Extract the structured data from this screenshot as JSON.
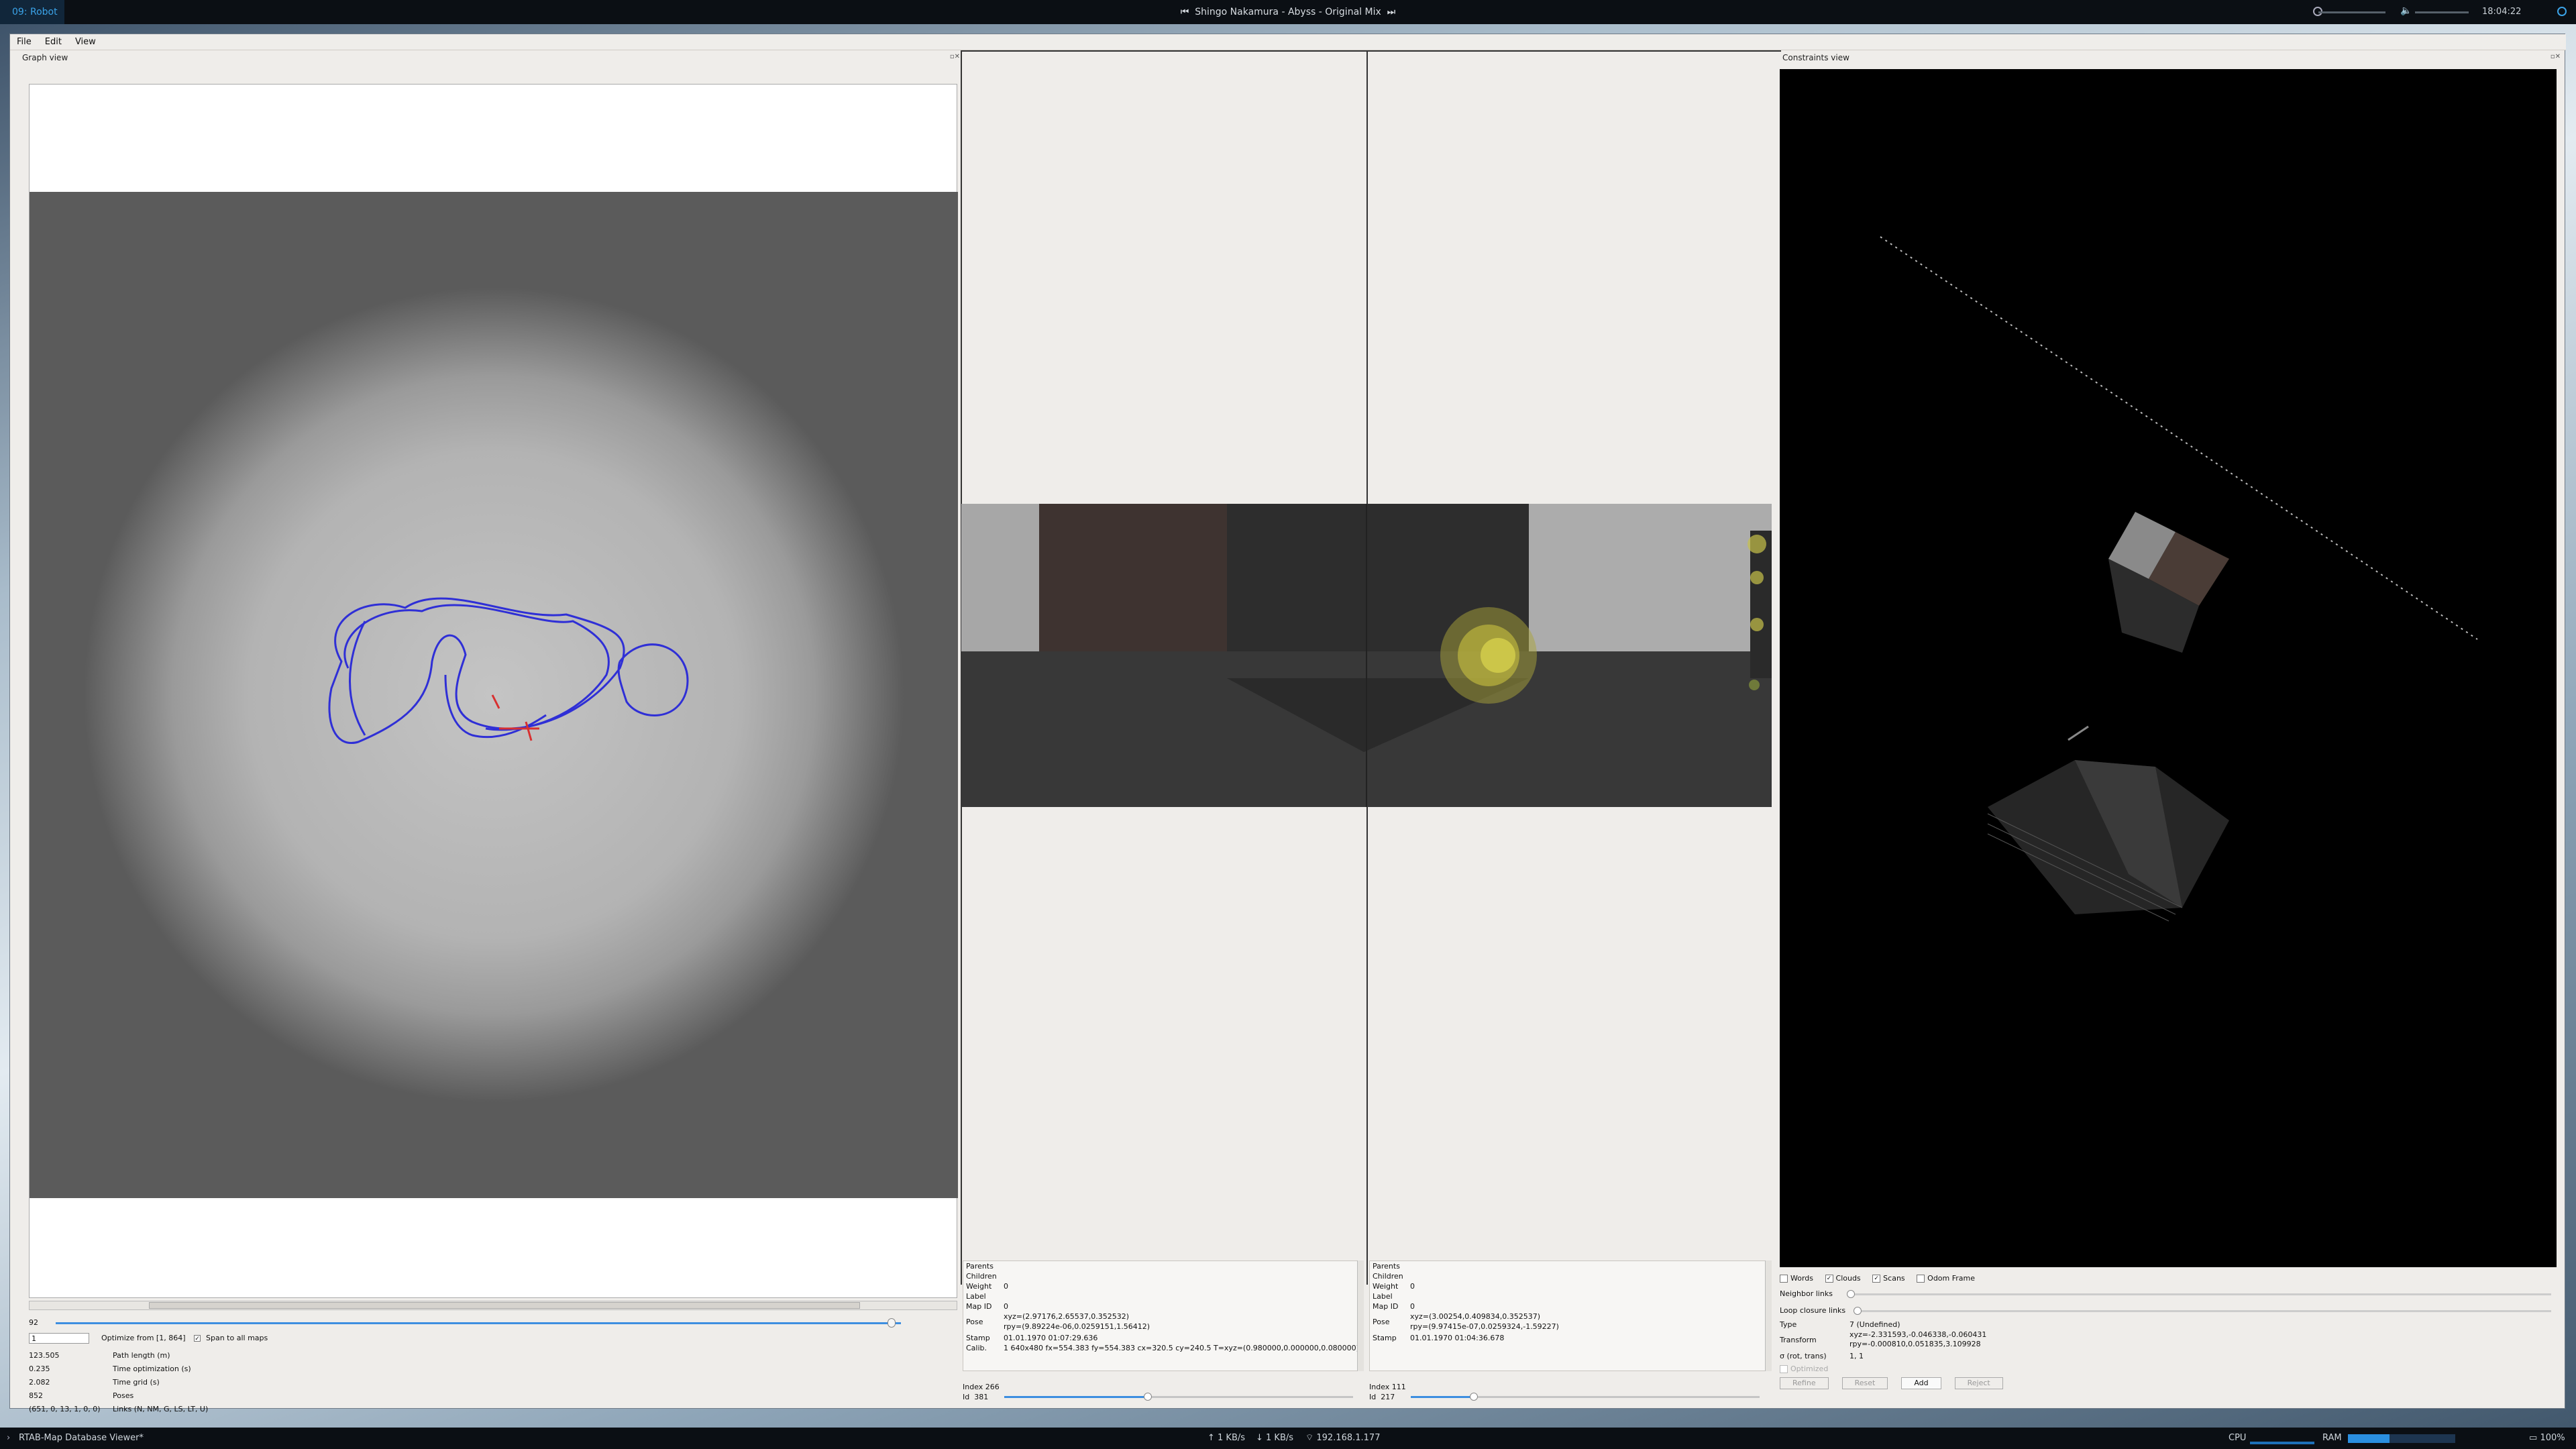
{
  "topbar": {
    "workspace": "09: Robot",
    "song": "Shingo Nakamura - Abyss - Original Mix",
    "clock": "18:04:22"
  },
  "window": {
    "menus": [
      "File",
      "Edit",
      "View"
    ]
  },
  "graph_view": {
    "title": "Graph view",
    "slider_label": "92",
    "optimize_value": "1",
    "optimize_label": "Optimize from [1, 864]",
    "span_label": "Span to all maps",
    "stats": [
      {
        "value": "123.505",
        "label": "Path length (m)"
      },
      {
        "value": "0.235",
        "label": "Time optimization (s)"
      },
      {
        "value": "2.082",
        "label": "Time grid (s)"
      },
      {
        "value": "852",
        "label": "Poses"
      },
      {
        "value": "(651, 0, 13, 1, 0, 0)",
        "label": "Links (N, NM, G, LS, LT, U)"
      }
    ]
  },
  "node_a": {
    "parents": "Parents",
    "children": "Children",
    "weight_label": "Weight",
    "weight": "0",
    "label_label": "Label",
    "label": "",
    "mapid_label": "Map ID",
    "mapid": "0",
    "pose_label": "Pose",
    "pose_xyz": "xyz=(2.97176,2.65537,0.352532)",
    "pose_rpy": "rpy=(9.89224e-06,0.0259151,1.56412)",
    "stamp_label": "Stamp",
    "stamp": "01.01.1970 01:07:29.636",
    "calib_label": "Calib.",
    "calib": "1 640x480 fx=554.383 fy=554.383 cx=320.5 cy=240.5 T=xyz=(0.980000,0.000000,0.080000) rpy=(...)",
    "index_label": "Index",
    "index": "266",
    "id_label": "Id",
    "id": "381"
  },
  "node_b": {
    "parents": "Parents",
    "children": "Children",
    "weight_label": "Weight",
    "weight": "0",
    "label_label": "Label",
    "label": "",
    "mapid_label": "Map ID",
    "mapid": "0",
    "pose_label": "Pose",
    "pose_xyz": "xyz=(3.00254,0.409834,0.352537)",
    "pose_rpy": "rpy=(9.97415e-07,0.0259324,-1.59227)",
    "stamp_label": "Stamp",
    "stamp": "01.01.1970 01:04:36.678",
    "index_label": "Index",
    "index": "111",
    "id_label": "Id",
    "id": "217"
  },
  "constraints": {
    "title": "Constraints view",
    "checkboxes": [
      {
        "label": "Words",
        "checked": false
      },
      {
        "label": "Clouds",
        "checked": true
      },
      {
        "label": "Scans",
        "checked": true
      },
      {
        "label": "Odom Frame",
        "checked": false
      }
    ],
    "neighbor_links": "Neighbor links",
    "loop_links": "Loop closure links",
    "type_label": "Type",
    "type_value": "7 (Undefined)",
    "transform_label": "Transform",
    "transform_xyz": "xyz=-2.331593,-0.046338,-0.060431",
    "transform_rpy": "rpy=-0.000810,0.051835,3.109928",
    "sigma_label": "σ (rot, trans)",
    "sigma_value": "1, 1",
    "optimized": "Optimized",
    "buttons": [
      "Refine",
      "Reset",
      "Add",
      "Reject"
    ]
  },
  "taskbar": {
    "app": "RTAB-Map Database Viewer*",
    "net_up": "1 KB/s",
    "net_down": "1 KB/s",
    "ip": "192.168.1.177",
    "cpu": "CPU",
    "ram": "RAM",
    "battery": "100%"
  }
}
